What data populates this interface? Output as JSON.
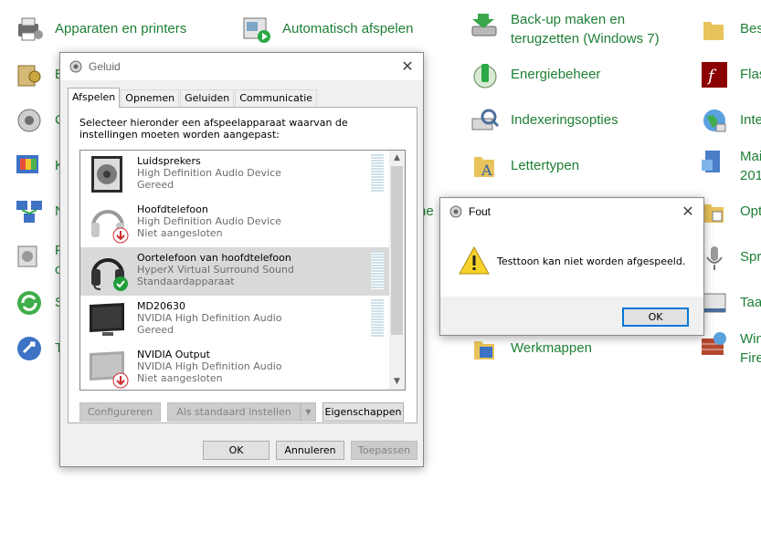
{
  "control_panel": {
    "items": [
      {
        "label": "Apparaten en printers",
        "icon": "printer-icon"
      },
      {
        "label": "Automatisch afspelen",
        "icon": "autoplay-icon"
      },
      {
        "label": "Back-up maken en terugzetten (Windows 7)",
        "icon": "backup-icon"
      },
      {
        "label": "Bes",
        "icon": "folder-icon"
      },
      {
        "label": "E",
        "icon": "credential-icon"
      },
      {
        "label": "Energiebeheer",
        "icon": "battery-icon"
      },
      {
        "label": "Flas",
        "icon": "flash-icon"
      },
      {
        "label": "C",
        "icon": "speaker-icon"
      },
      {
        "label": "Indexeringsopties",
        "icon": "index-icon"
      },
      {
        "label": "Inte",
        "icon": "globe-icon"
      },
      {
        "label": "K",
        "icon": "color-icon"
      },
      {
        "label": "Lettertypen",
        "icon": "font-folder-icon"
      },
      {
        "label": "Mai",
        "icon": "mail-icon"
      },
      {
        "label": "201",
        "icon": ""
      },
      {
        "label": "N",
        "icon": "network-icon"
      },
      {
        "label": "he",
        "icon": ""
      },
      {
        "label": "Opt",
        "icon": "folder-options-icon"
      },
      {
        "label": "P",
        "icon": "programs-icon"
      },
      {
        "label": "c",
        "icon": ""
      },
      {
        "label": "Spr",
        "icon": "microphone-icon"
      },
      {
        "label": "S",
        "icon": "sync-icon"
      },
      {
        "label": "Taa",
        "icon": "taskbar-icon"
      },
      {
        "label": "T",
        "icon": "troubleshoot-icon"
      },
      {
        "label": "Werkmappen",
        "icon": "workfolders-icon"
      },
      {
        "label": "Win",
        "icon": "firewall-icon"
      },
      {
        "label": "Fire",
        "icon": ""
      }
    ]
  },
  "sound_dialog": {
    "title": "Geluid",
    "close": "✕",
    "tabs": [
      "Afspelen",
      "Opnemen",
      "Geluiden",
      "Communicatie"
    ],
    "active_tab": "Afspelen",
    "intro": "Selecteer hieronder een afspeelapparaat waarvan de instellingen moeten worden aangepast:",
    "devices": [
      {
        "name": "Luidsprekers",
        "driver": "High Definition Audio Device",
        "status": "Gereed",
        "icon": "speakers-icon",
        "badge": ""
      },
      {
        "name": "Hoofdtelefoon",
        "driver": "High Definition Audio Device",
        "status": "Niet aangesloten",
        "icon": "headphones-icon",
        "badge": "unplugged"
      },
      {
        "name": "Oortelefoon van hoofdtelefoon",
        "driver": "HyperX Virtual Surround Sound",
        "status": "Standaardapparaat",
        "icon": "headset-icon",
        "badge": "default"
      },
      {
        "name": "MD20630",
        "driver": "NVIDIA High Definition Audio",
        "status": "Gereed",
        "icon": "monitor-icon",
        "badge": ""
      },
      {
        "name": "NVIDIA Output",
        "driver": "NVIDIA High Definition Audio",
        "status": "Niet aangesloten",
        "icon": "monitor-icon",
        "badge": "unplugged"
      }
    ],
    "selected_device": "Oortelefoon van hoofdtelefoon",
    "buttons": {
      "configure": "Configureren",
      "set_default": "Als standaard instellen",
      "properties": "Eigenschappen",
      "ok": "OK",
      "cancel": "Annuleren",
      "apply": "Toepassen"
    }
  },
  "error_dialog": {
    "title": "Fout",
    "close": "✕",
    "message": "Testtoon kan niet worden afgespeeld.",
    "ok": "OK"
  },
  "colors": {
    "link_green": "#1e7f35",
    "accent_blue": "#0078d7",
    "selected_row": "#d9d9d9"
  }
}
